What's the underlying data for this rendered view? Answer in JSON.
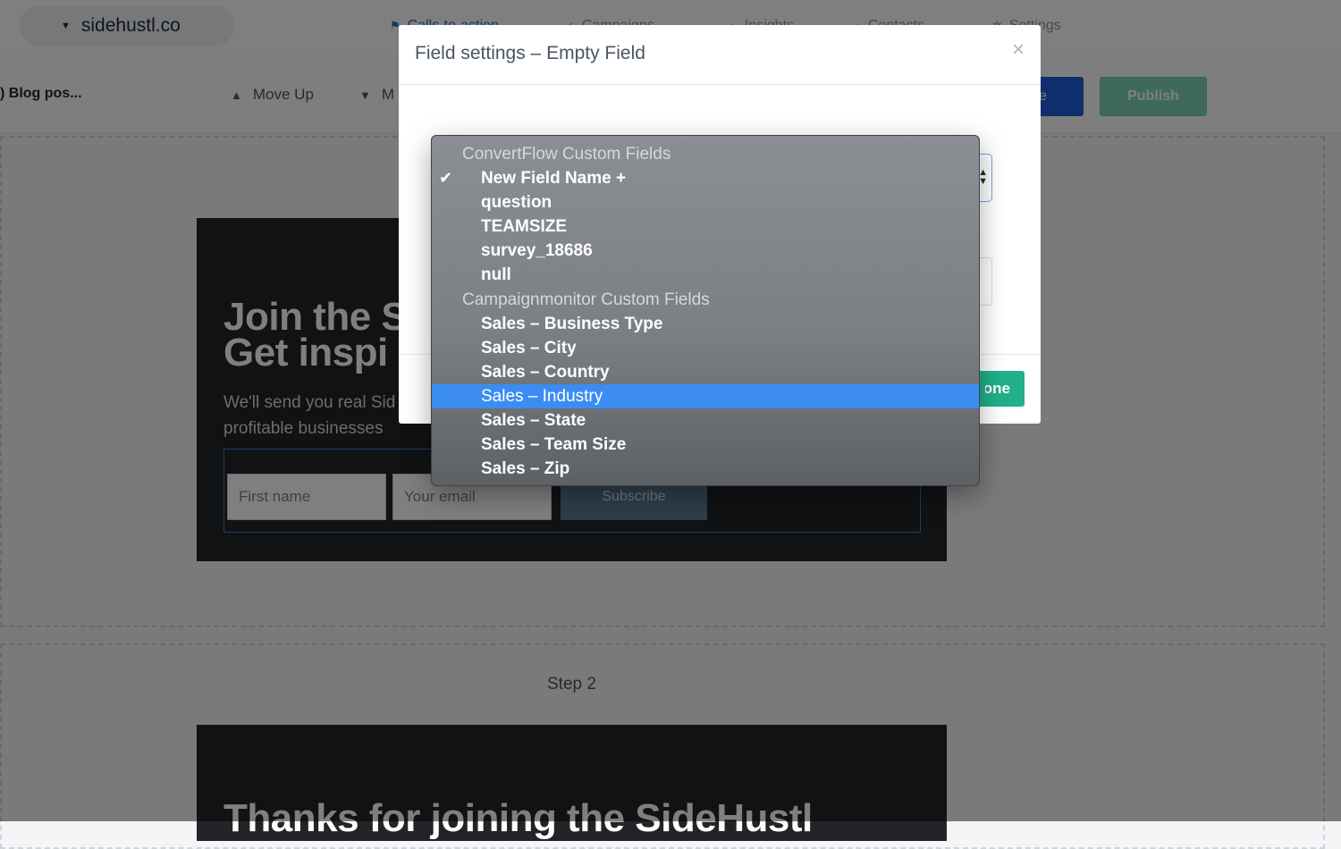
{
  "app": {
    "site_name": "sidehustl.co",
    "nav": [
      {
        "label": "Calls-to-action",
        "icon": "flag-icon"
      },
      {
        "label": "Campaigns",
        "icon": "check-icon"
      },
      {
        "label": "Insights",
        "icon": "chart-icon"
      },
      {
        "label": "Contacts",
        "icon": "person-icon"
      },
      {
        "label": "Settings",
        "icon": "gear-icon"
      }
    ]
  },
  "toolbar": {
    "breadcrumb": ") Blog pos...",
    "move_up": "Move Up",
    "move_down": "M",
    "save_label": "e",
    "publish_label": "Publish"
  },
  "canvas": {
    "step1": {
      "title_line1": "Join the S",
      "title_line2": "Get inspi",
      "subtitle_line1": "We'll send you real Sid",
      "subtitle_line2": "profitable businesses",
      "first_name_placeholder": "First name",
      "email_placeholder": "Your email",
      "subscribe_label": "Subscribe"
    },
    "step2": {
      "label": "Step 2",
      "title": "Thanks for joining the SideHustl"
    }
  },
  "modal": {
    "title": "Field settings – Empty Field",
    "close_glyph": "×",
    "done_label": "Done"
  },
  "dropdown": {
    "groups": [
      {
        "label": "ConvertFlow Custom Fields",
        "options": [
          "New Field Name +",
          "question",
          "TEAMSIZE",
          "survey_18686",
          "null"
        ]
      },
      {
        "label": "Campaignmonitor Custom Fields",
        "options": [
          "Sales – Business Type",
          "Sales – City",
          "Sales – Country",
          "Sales – Industry",
          "Sales – State",
          "Sales – Team Size",
          "Sales – Zip"
        ]
      }
    ],
    "checked_option": "New Field Name +",
    "highlighted_option": "Sales – Industry"
  },
  "colors": {
    "highlight": "#3b8df2",
    "done_button": "#21b08a",
    "publish_button": "#7fd3b8",
    "primary_button": "#1c5fd6"
  }
}
